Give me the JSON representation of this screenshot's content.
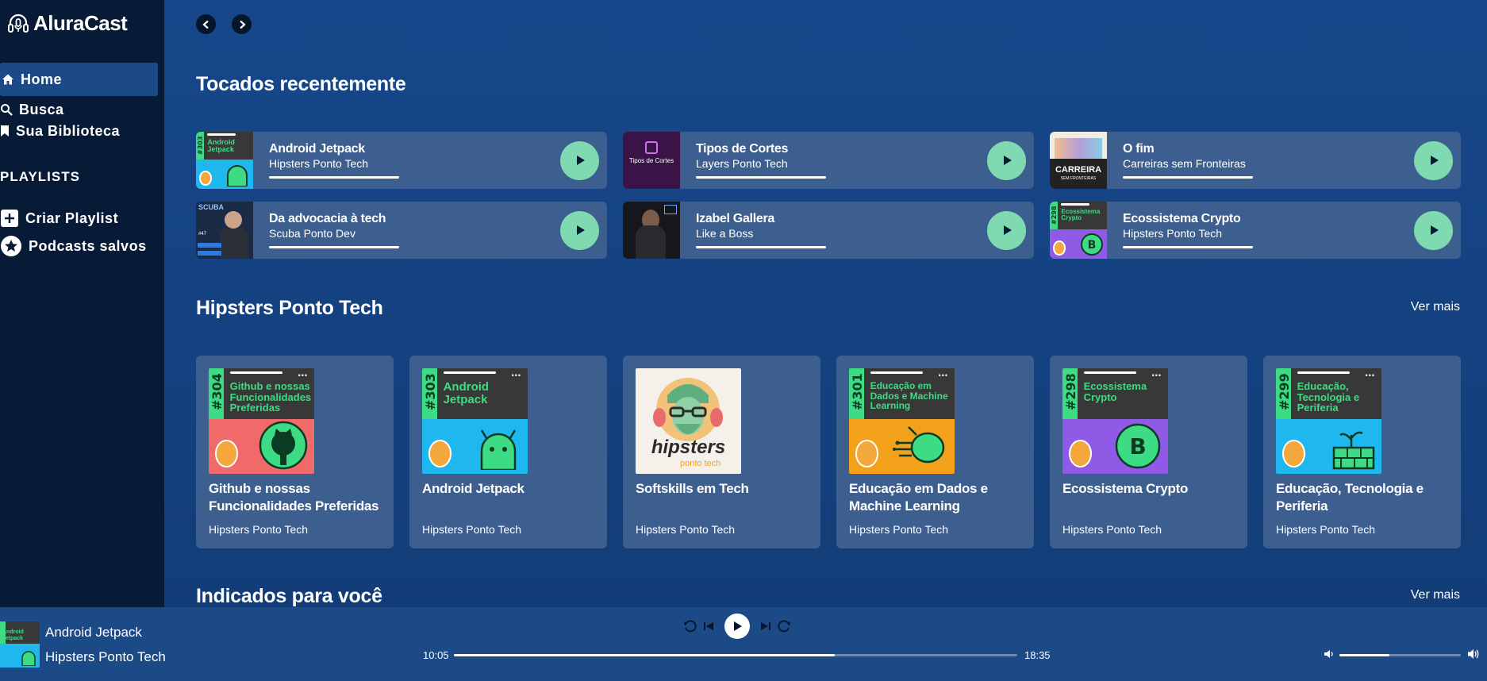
{
  "app": {
    "logo_text": "AluraCast"
  },
  "sidebar": {
    "home": "Home",
    "busca": "Busca",
    "biblioteca": "Sua Biblioteca",
    "playlists_title": "PLAYLISTS",
    "criar_playlist": "Criar Playlist",
    "podcasts_salvos": "Podcasts salvos"
  },
  "sections": {
    "recent_title": "Tocados recentemente",
    "hipsters_title": "Hipsters Ponto Tech",
    "hipsters_more": "Ver mais",
    "indicados_title": "Indicados para você",
    "indicados_more": "Ver mais"
  },
  "recent": [
    {
      "title": "Android Jetpack",
      "subtitle": "Hipsters Ponto Tech",
      "thumb_text": "Android Jetpack",
      "thumb_num": "#303"
    },
    {
      "title": "Tipos de Cortes",
      "subtitle": "Layers Ponto Tech",
      "thumb_text": "Tipos de Cortes"
    },
    {
      "title": "O fim",
      "subtitle": "Carreiras sem Fronteiras",
      "thumb_text": "CARREIRA",
      "thumb_sub": "SEM FRONTEIRAS"
    },
    {
      "title": "Da advocacia à tech",
      "subtitle": "Scuba Ponto Dev",
      "thumb_text": "SCUBA",
      "thumb_num": "#47"
    },
    {
      "title": "Izabel Gallera",
      "subtitle": "Like a Boss"
    },
    {
      "title": "Ecossistema Crypto",
      "subtitle": "Hipsters Ponto Tech",
      "thumb_text": "Ecossistema Crypto",
      "thumb_num": "#298"
    }
  ],
  "hipsters": [
    {
      "title": "Github e nossas Funcionalidades Preferidas",
      "author": "Hipsters Ponto Tech",
      "num": "#304",
      "art_text": "Github e nossas Funcionalidades Preferidas",
      "bg": "#f06a6a"
    },
    {
      "title": "Android Jetpack",
      "author": "Hipsters Ponto Tech",
      "num": "#303",
      "art_text": "Android Jetpack",
      "bg": "#1fb8ee"
    },
    {
      "title": "Softskills em Tech",
      "author": "Hipsters Ponto Tech",
      "logo_text": "hipsters",
      "logo_sub": "ponto tech"
    },
    {
      "title": "Educação em Dados e Machine Learning",
      "author": "Hipsters Ponto Tech",
      "num": "#301",
      "art_text": "Educação em Dados e Machine Learning",
      "bg": "#f3a11b"
    },
    {
      "title": "Ecossistema Crypto",
      "author": "Hipsters Ponto Tech",
      "num": "#298",
      "art_text": "Ecossistema Crypto",
      "bg": "#8e5ae6"
    },
    {
      "title": "Educação, Tecnologia e Periferia",
      "author": "Hipsters Ponto Tech",
      "num": "#299",
      "art_text": "Educação, Tecnologia e Periferia",
      "bg": "#1fb8ee"
    }
  ],
  "player": {
    "title": "Android Jetpack",
    "subtitle": "Hipsters Ponto Tech",
    "thumb_text": "Android Jetpack",
    "current_time": "10:05",
    "total_time": "18:35",
    "progress": 0.676,
    "volume": 0.41
  },
  "colors": {
    "sidebar_bg": "#071a36",
    "main_bg": "#17478a",
    "card_bg": "#3d5f8f",
    "accent_play": "#7fdab1",
    "android_green": "#3ddc84"
  },
  "icons": {
    "logo": "headphones-icon",
    "home": "home-icon",
    "busca": "search-icon",
    "biblioteca": "bookmark-icon",
    "criar": "plus-square-icon",
    "salvos": "star-circle-icon"
  }
}
